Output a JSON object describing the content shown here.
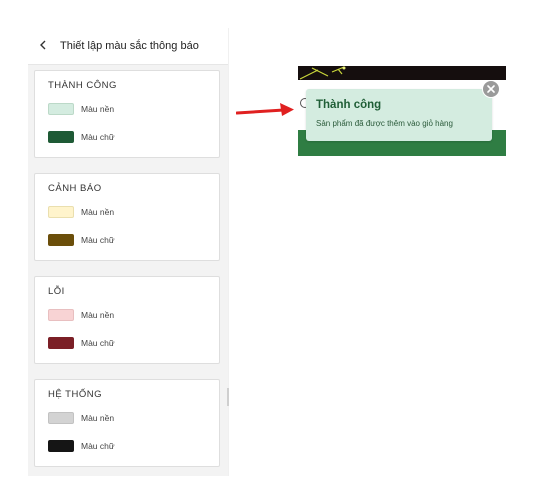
{
  "panel": {
    "title": "Thiết lập màu sắc thông báo",
    "back_icon": "chevron-left-icon",
    "sections": [
      {
        "title": "THÀNH CÔNG",
        "bg_label": "Màu nền",
        "text_label": "Màu chữ",
        "bg_color": "#d4ece0",
        "text_color": "#1e5a35"
      },
      {
        "title": "CẢNH BÁO",
        "bg_label": "Màu nền",
        "text_label": "Màu chữ",
        "bg_color": "#fff4cc",
        "text_color": "#6b4e0a"
      },
      {
        "title": "LỖI",
        "bg_label": "Màu nền",
        "text_label": "Màu chữ",
        "bg_color": "#f8d3d4",
        "text_color": "#7b1f26"
      },
      {
        "title": "HỆ THỐNG",
        "bg_label": "Màu nền",
        "text_label": "Màu chữ",
        "bg_color": "#d3d3d3",
        "text_color": "#151515"
      }
    ]
  },
  "preview": {
    "toast": {
      "title": "Thành công",
      "message": "Sản phẩm đã được thêm vào giỏ hàng",
      "close_icon": "close-icon"
    },
    "arrow_icon": "red-arrow-right-icon",
    "colors": {
      "green_bar": "#2f7d43",
      "arrow": "#e02020"
    }
  }
}
